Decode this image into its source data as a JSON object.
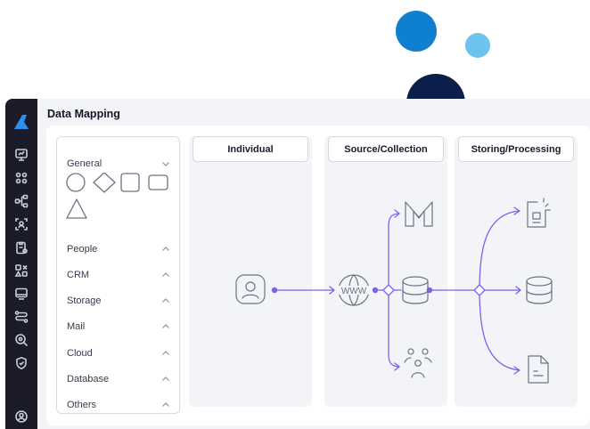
{
  "header": {
    "title": "Data Mapping"
  },
  "palette": {
    "categories": [
      {
        "label": "General",
        "expanded": true
      },
      {
        "label": "People",
        "expanded": false
      },
      {
        "label": "CRM",
        "expanded": false
      },
      {
        "label": "Storage",
        "expanded": false
      },
      {
        "label": "Mail",
        "expanded": false
      },
      {
        "label": "Cloud",
        "expanded": false
      },
      {
        "label": "Database",
        "expanded": false
      },
      {
        "label": "Others",
        "expanded": false
      }
    ],
    "shapes": [
      "circle",
      "diamond",
      "square",
      "rounded-rectangle",
      "triangle"
    ]
  },
  "columns": [
    {
      "label": "Individual"
    },
    {
      "label": "Source/Collection"
    },
    {
      "label": "Storing/Processing"
    }
  ],
  "flow": {
    "globe_label": "WWW",
    "nodes": [
      "person-icon",
      "web-icon",
      "database-icon",
      "mail-icon",
      "people-group-icon",
      "report-icon",
      "storage-database-icon",
      "document-icon"
    ]
  },
  "colors": {
    "accent": "#7b61f0",
    "rail": "#1b1b2a",
    "deco_blue": "#0f7fd0",
    "deco_light_blue": "#6cc3ee",
    "deco_navy": "#0b1f4a"
  },
  "rail_icons": [
    "app-logo-icon",
    "dashboard-icon",
    "apps-grid-icon",
    "network-icon",
    "scan-icon",
    "clipboard-settings-icon",
    "shapes-icon",
    "monitor-icon",
    "flow-icon",
    "search-settings-icon",
    "shield-icon",
    "user-icon"
  ]
}
